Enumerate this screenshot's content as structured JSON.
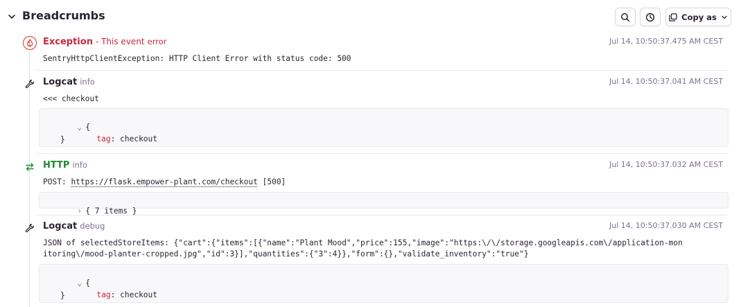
{
  "header": {
    "title": "Breadcrumbs",
    "copy_label": "Copy as",
    "icons": {
      "collapse": "chevron-down-icon",
      "search": "search-icon",
      "time": "clock-icon",
      "copy": "copy-icon",
      "dropdown": "chevron-down-icon"
    }
  },
  "colors": {
    "error": "#c8283f",
    "http": "#1d8a33",
    "muted": "#80708f",
    "text": "#2b2233"
  },
  "crumbs": [
    {
      "type": "Exception",
      "sub": "- This event",
      "level": "error",
      "time": "Jul 14, 10:50:37.475 AM CEST",
      "message": "SentryHttpClientException: HTTP Client Error with status code: 500",
      "icon": "fire-icon"
    },
    {
      "type": "Logcat",
      "level": "info",
      "time": "Jul 14, 10:50:37.041 AM CEST",
      "message": "<<< checkout",
      "icon": "wrench-icon",
      "data": {
        "open": "{",
        "key": "tag",
        "value": "checkout",
        "close": "}"
      }
    },
    {
      "type": "HTTP",
      "level": "info",
      "time": "Jul 14, 10:50:37.032 AM CEST",
      "method": "POST:",
      "url": "https://flask.empower-plant.com/checkout",
      "status": "[500]",
      "icon": "arrows-swap-icon",
      "data": {
        "collapsed": "{ 7 items }"
      }
    },
    {
      "type": "Logcat",
      "level": "debug",
      "time": "Jul 14, 10:50:37.030 AM CEST",
      "message_line1": "JSON of selectedStoreItems: {\"cart\":{\"items\":[{\"name\":\"Plant Mood\",\"price\":155,\"image\":\"https:\\/\\/storage.googleapis.com\\/application-mon",
      "message_line2": "itoring\\/mood-planter-cropped.jpg\",\"id\":3}],\"quantities\":{\"3\":4}},\"form\":{},\"validate_inventory\":\"true\"}",
      "icon": "wrench-icon",
      "data": {
        "open": "{",
        "key": "tag",
        "value": "checkout",
        "close": "}"
      }
    }
  ]
}
